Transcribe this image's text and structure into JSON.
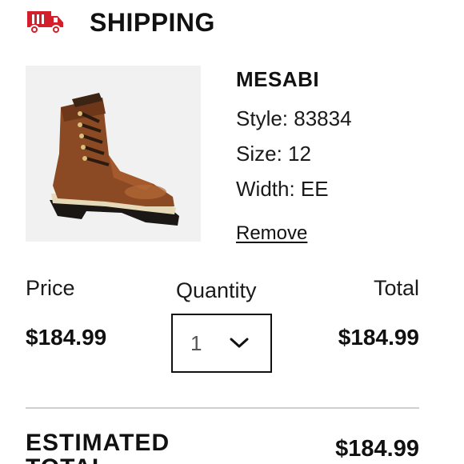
{
  "header": {
    "icon": "truck-icon",
    "title": "SHIPPING",
    "accent_color": "#d21f2b"
  },
  "product": {
    "image": "boot-image",
    "name": "MESABI",
    "style": "Style: 83834",
    "size": "Size: 12",
    "width": "Width: EE",
    "remove_label": "Remove"
  },
  "pricing": {
    "price_label": "Price",
    "quantity_label": "Quantity",
    "total_label": "Total",
    "price_value": "$184.99",
    "quantity_value": "1",
    "quantity_icon": "chevron-down-icon",
    "total_value": "$184.99"
  },
  "summary": {
    "estimated_label": "ESTIMATED TOTAL",
    "estimated_value": "$184.99"
  }
}
